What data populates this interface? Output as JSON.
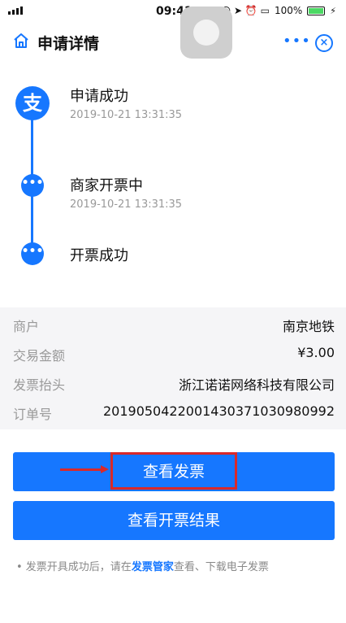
{
  "status_bar": {
    "time": "09:41",
    "battery": "100%"
  },
  "nav": {
    "title": "申请详情"
  },
  "timeline": [
    {
      "title": "申请成功",
      "time": "2019-10-21 13:31:35"
    },
    {
      "title": "商家开票中",
      "time": "2019-10-21 13:31:35"
    },
    {
      "title": "开票成功",
      "time": ""
    }
  ],
  "logo_text": "支",
  "details": [
    {
      "label": "商户",
      "value": "南京地铁"
    },
    {
      "label": "交易金额",
      "value": "¥3.00"
    },
    {
      "label": "发票抬头",
      "value": "浙江诺诺网络科技有限公司"
    },
    {
      "label": "订单号",
      "value": "2019050422001430371030980992"
    }
  ],
  "buttons": {
    "view_invoice": "查看发票",
    "view_result": "查看开票结果"
  },
  "tip": {
    "prefix": "• 发票开具成功后，请在",
    "link": "发票管家",
    "suffix": "查看、下载电子发票"
  },
  "colors": {
    "accent": "#1677ff",
    "annotation": "#d9292a"
  }
}
